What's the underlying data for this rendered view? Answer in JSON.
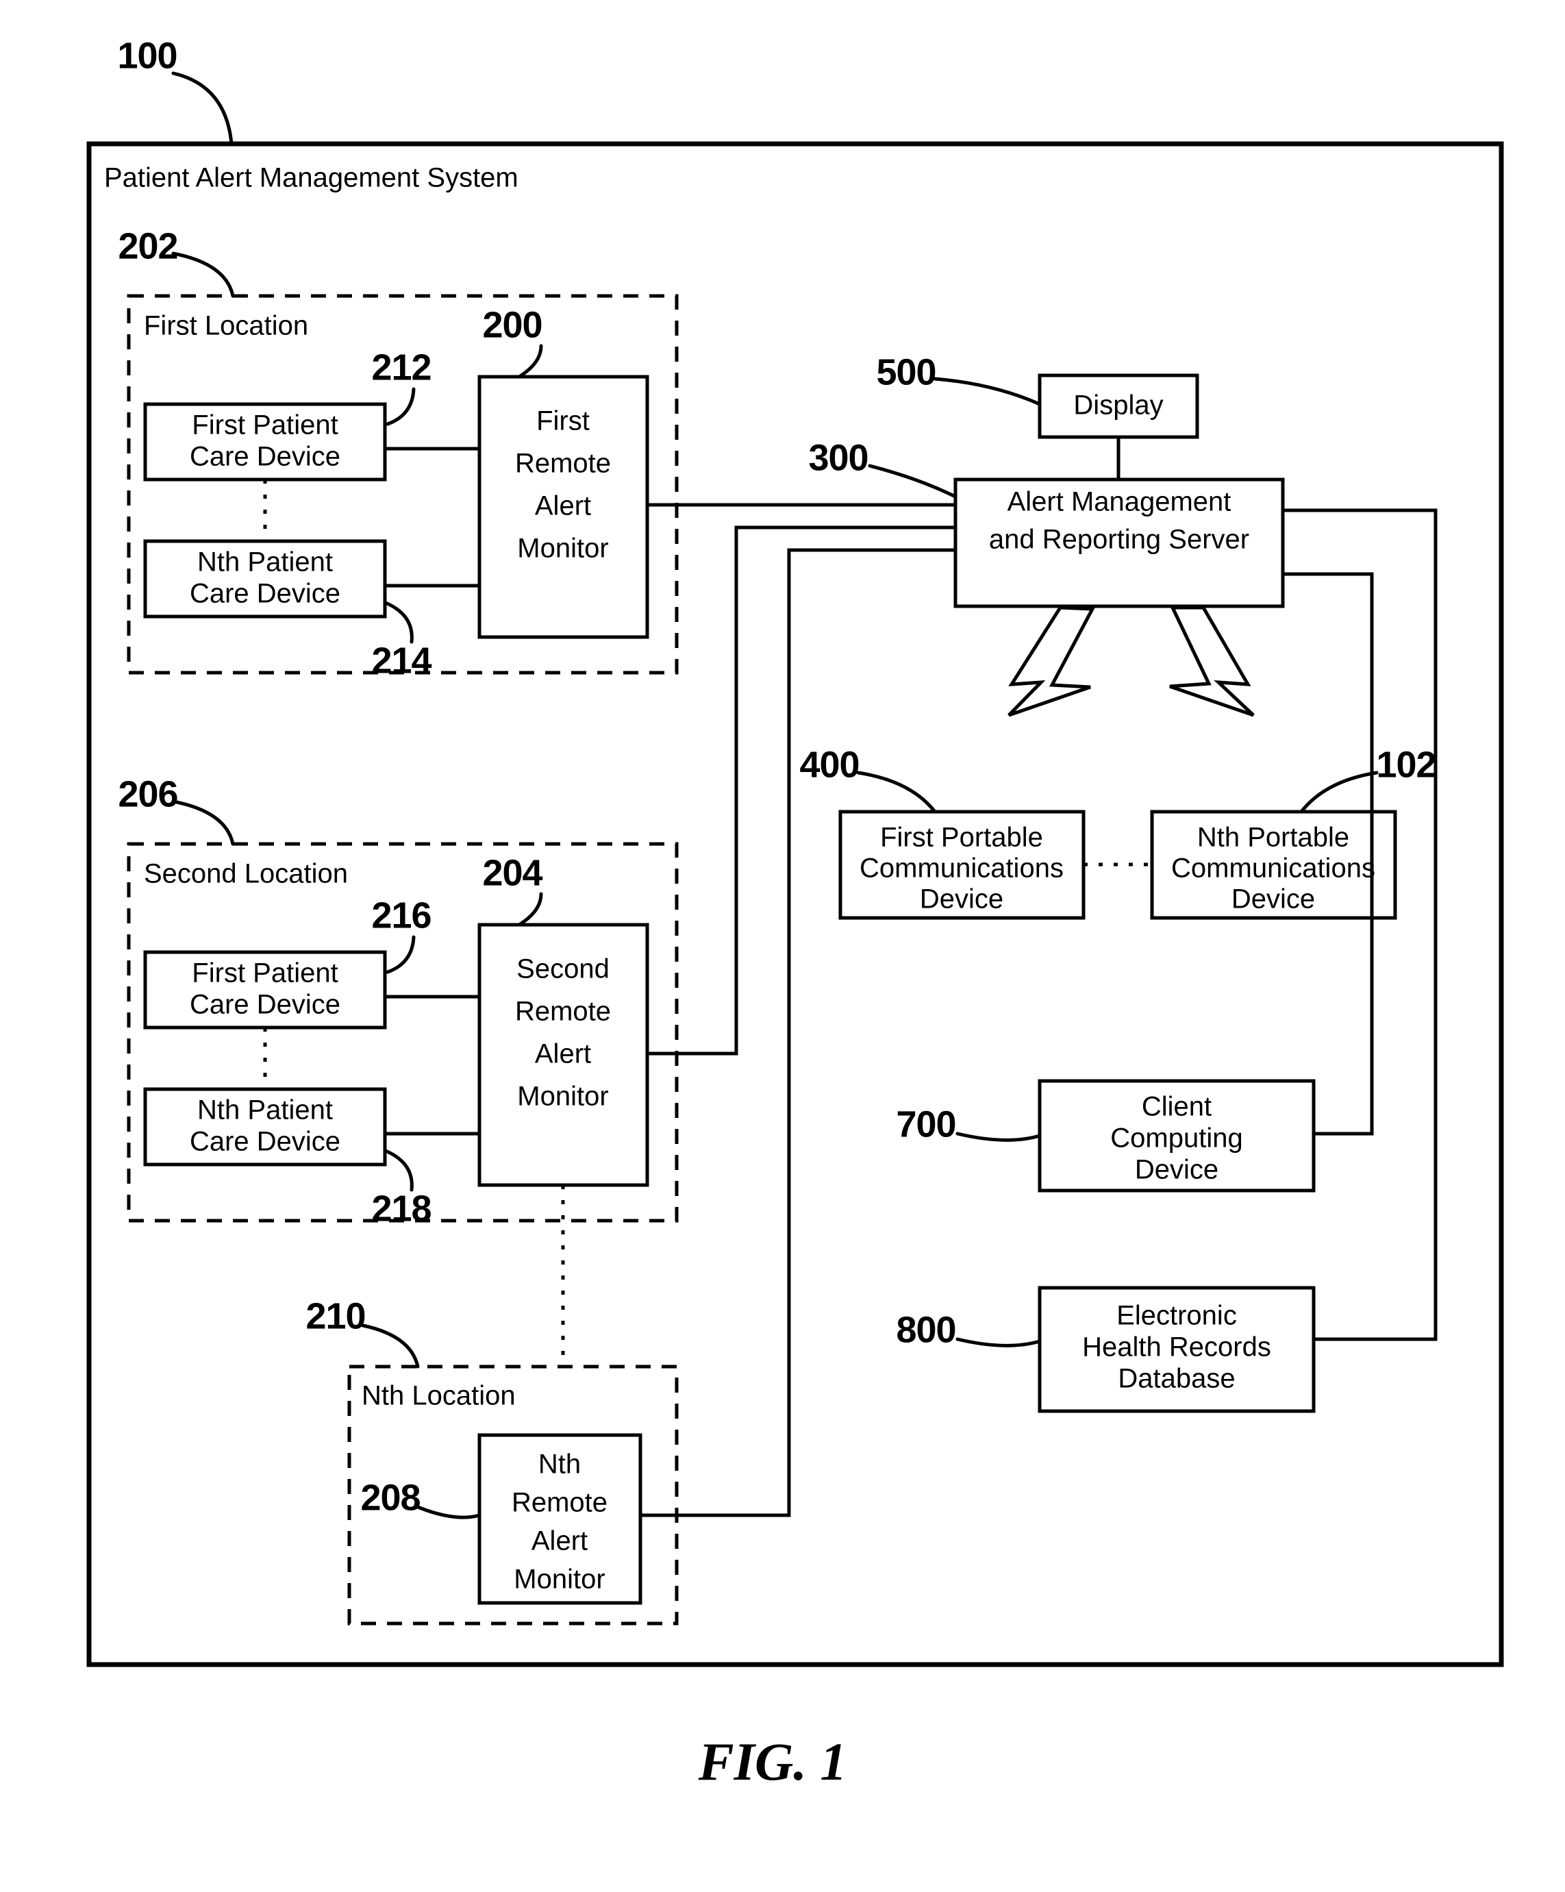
{
  "figure": {
    "caption": "FIG. 1",
    "system_ref": "100",
    "system_title": "Patient Alert Management System"
  },
  "locations": [
    {
      "ref": "202",
      "title": "First Location",
      "devices": [
        {
          "ref": "212",
          "label_line1": "First Patient",
          "label_line2": "Care Device"
        },
        {
          "ref": "214",
          "label_line1": "Nth Patient",
          "label_line2": "Care Device"
        }
      ],
      "monitor": {
        "ref": "200",
        "label_line1": "First",
        "label_line2": "Remote",
        "label_line3": "Alert",
        "label_line4": "Monitor"
      }
    },
    {
      "ref": "206",
      "title": "Second Location",
      "devices": [
        {
          "ref": "216",
          "label_line1": "First Patient",
          "label_line2": "Care Device"
        },
        {
          "ref": "218",
          "label_line1": "Nth Patient",
          "label_line2": "Care Device"
        }
      ],
      "monitor": {
        "ref": "204",
        "label_line1": "Second",
        "label_line2": "Remote",
        "label_line3": "Alert",
        "label_line4": "Monitor"
      }
    },
    {
      "ref": "210",
      "title": "Nth Location",
      "devices": [],
      "monitor": {
        "ref": "208",
        "label_line1": "Nth",
        "label_line2": "Remote",
        "label_line3": "Alert",
        "label_line4": "Monitor"
      }
    }
  ],
  "server": {
    "ref": "300",
    "label_line1": "Alert Management",
    "label_line2": "and Reporting Server"
  },
  "display": {
    "ref": "500",
    "label": "Display"
  },
  "portable_devices": [
    {
      "ref": "400",
      "label_line1": "First Portable",
      "label_line2": "Communications",
      "label_line3": "Device"
    },
    {
      "ref": "102",
      "label_line1": "Nth Portable",
      "label_line2": "Communications",
      "label_line3": "Device"
    }
  ],
  "client_device": {
    "ref": "700",
    "label_line1": "Client",
    "label_line2": "Computing",
    "label_line3": "Device"
  },
  "ehr_database": {
    "ref": "800",
    "label_line1": "Electronic",
    "label_line2": "Health Records",
    "label_line3": "Database"
  },
  "colors": {
    "line": "#000000",
    "background": "#ffffff"
  }
}
